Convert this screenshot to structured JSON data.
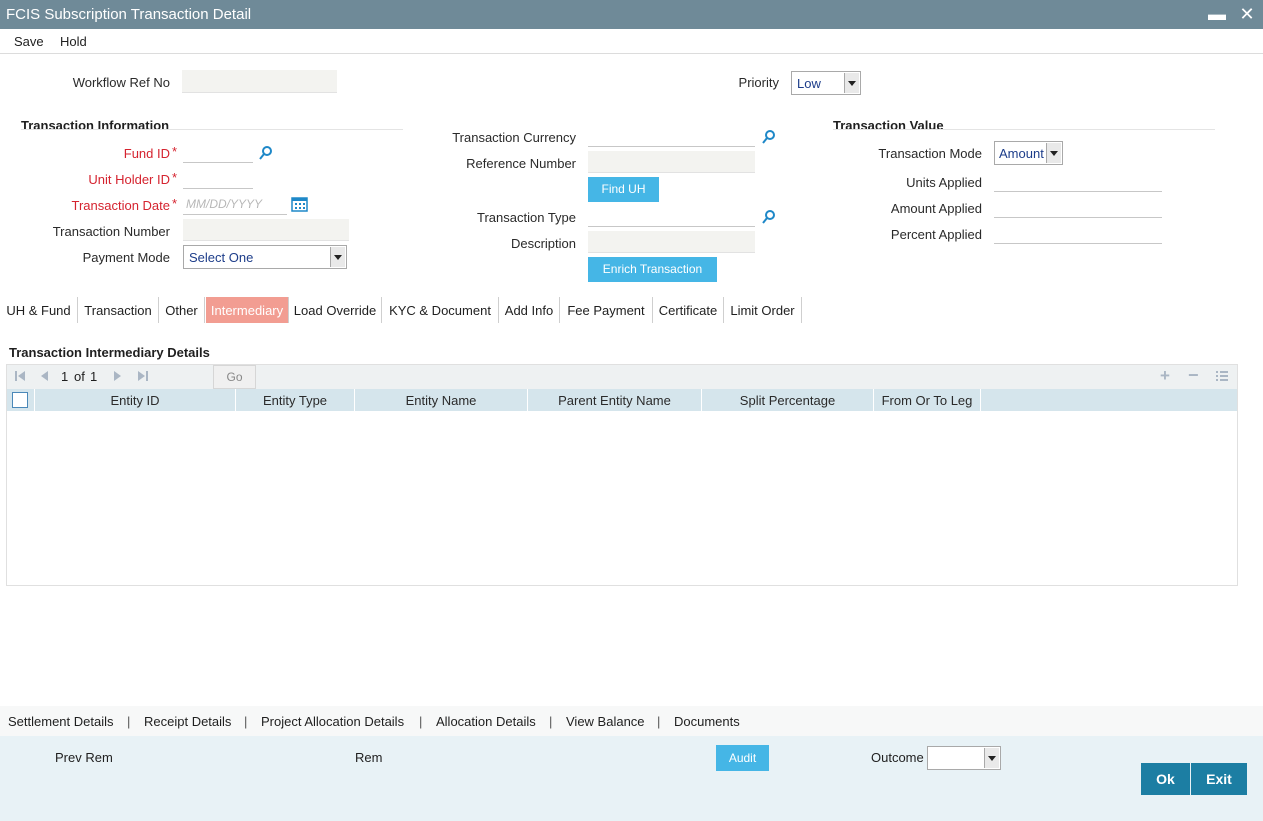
{
  "window": {
    "title": "FCIS Subscription Transaction Detail",
    "minimize": "▬",
    "close": "✕"
  },
  "menu": {
    "save": "Save",
    "hold": "Hold"
  },
  "header": {
    "workflow_ref_label": "Workflow Ref No",
    "workflow_ref_value": "",
    "priority_label": "Priority",
    "priority_value": "Low"
  },
  "transaction_info": {
    "title": "Transaction Information",
    "fund_id_label": "Fund ID",
    "unit_holder_id_label": "Unit Holder ID",
    "transaction_date_label": "Transaction Date",
    "transaction_date_placeholder": "MM/DD/YYYY",
    "transaction_number_label": "Transaction Number",
    "payment_mode_label": "Payment Mode",
    "payment_mode_value": "Select One",
    "required_mark": "*"
  },
  "middle": {
    "transaction_currency_label": "Transaction Currency",
    "reference_number_label": "Reference Number",
    "find_uh_button": "Find UH",
    "transaction_type_label": "Transaction Type",
    "description_label": "Description",
    "enrich_button": "Enrich Transaction"
  },
  "transaction_value": {
    "title": "Transaction Value",
    "mode_label": "Transaction Mode",
    "mode_value": "Amount",
    "units_applied_label": "Units Applied",
    "amount_applied_label": "Amount Applied",
    "percent_applied_label": "Percent Applied"
  },
  "tabs": [
    {
      "label": "UH & Fund"
    },
    {
      "label": "Transaction"
    },
    {
      "label": "Other"
    },
    {
      "label": "Intermediary"
    },
    {
      "label": "Load Override"
    },
    {
      "label": "KYC & Document"
    },
    {
      "label": "Add Info"
    },
    {
      "label": "Fee Payment"
    },
    {
      "label": "Certificate"
    },
    {
      "label": "Limit Order"
    }
  ],
  "active_tab": "Intermediary",
  "grid": {
    "title": "Transaction Intermediary Details",
    "page_current": "1",
    "page_of": "of",
    "page_total": "1",
    "go_button": "Go",
    "columns": [
      "Entity ID",
      "Entity Type",
      "Entity Name",
      "Parent Entity Name",
      "Split Percentage",
      "From Or To Leg"
    ],
    "rows": []
  },
  "footer_links": [
    "Settlement Details",
    "Receipt Details",
    "Project Allocation Details",
    "Allocation Details",
    "View Balance",
    "Documents"
  ],
  "footer_separator": "|",
  "footer": {
    "prev_rem_label": "Prev Rem",
    "rem_label": "Rem",
    "audit_button": "Audit",
    "outcome_label": "Outcome",
    "outcome_value": "",
    "ok_button": "Ok",
    "exit_button": "Exit"
  },
  "colors": {
    "titlebar": "#6f8a98",
    "accent_blue": "#45b6e6",
    "active_tab": "#f29d92",
    "required": "#d5232f",
    "dark_button": "#1c7ea3"
  }
}
